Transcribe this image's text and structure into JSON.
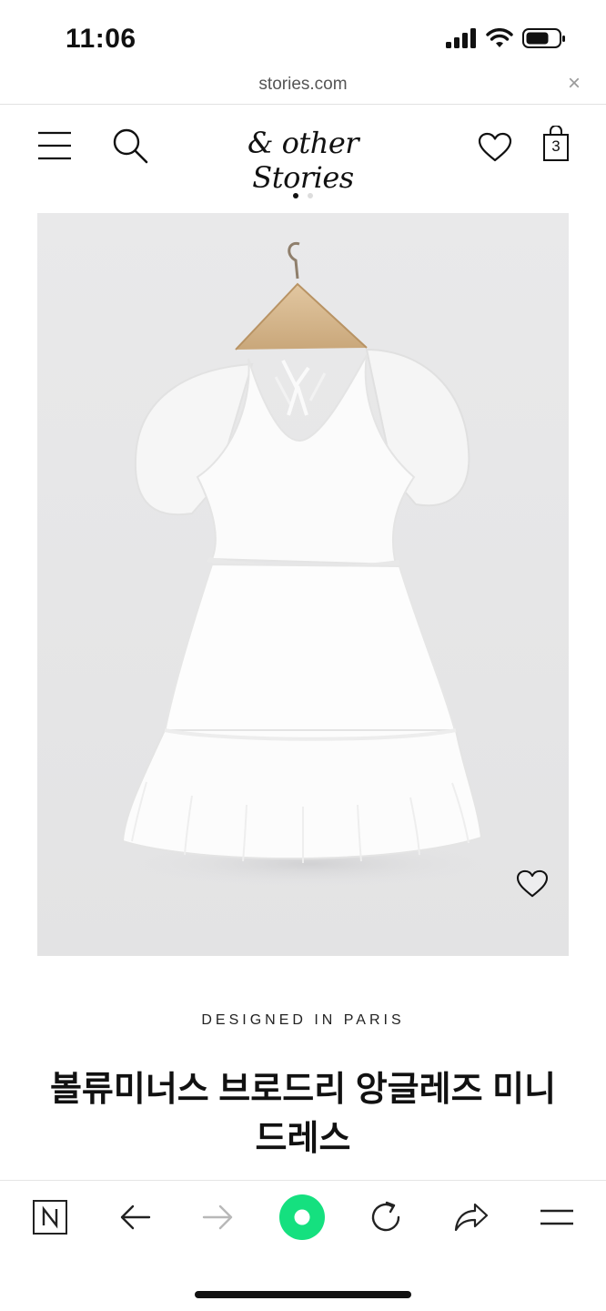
{
  "status_bar": {
    "time": "11:06"
  },
  "browser": {
    "url": "stories.com",
    "close_label": "×"
  },
  "site_nav": {
    "brand": "& other Stories",
    "cart_count": "3"
  },
  "carousel": {
    "total": 2,
    "active": 1
  },
  "product": {
    "eyebrow": "DESIGNED IN PARIS",
    "title": "볼류미너스 브로드리 앙글레즈 미니 드레스"
  },
  "toolbar": {
    "buttons": [
      "n-logo-icon",
      "back-arrow-icon",
      "forward-arrow-icon",
      "home-dot-icon",
      "reload-icon",
      "share-icon",
      "menu-icon"
    ],
    "accent": "#15e07f"
  },
  "colors": {
    "image_bg": "#e8e8e8",
    "text": "#111111"
  }
}
